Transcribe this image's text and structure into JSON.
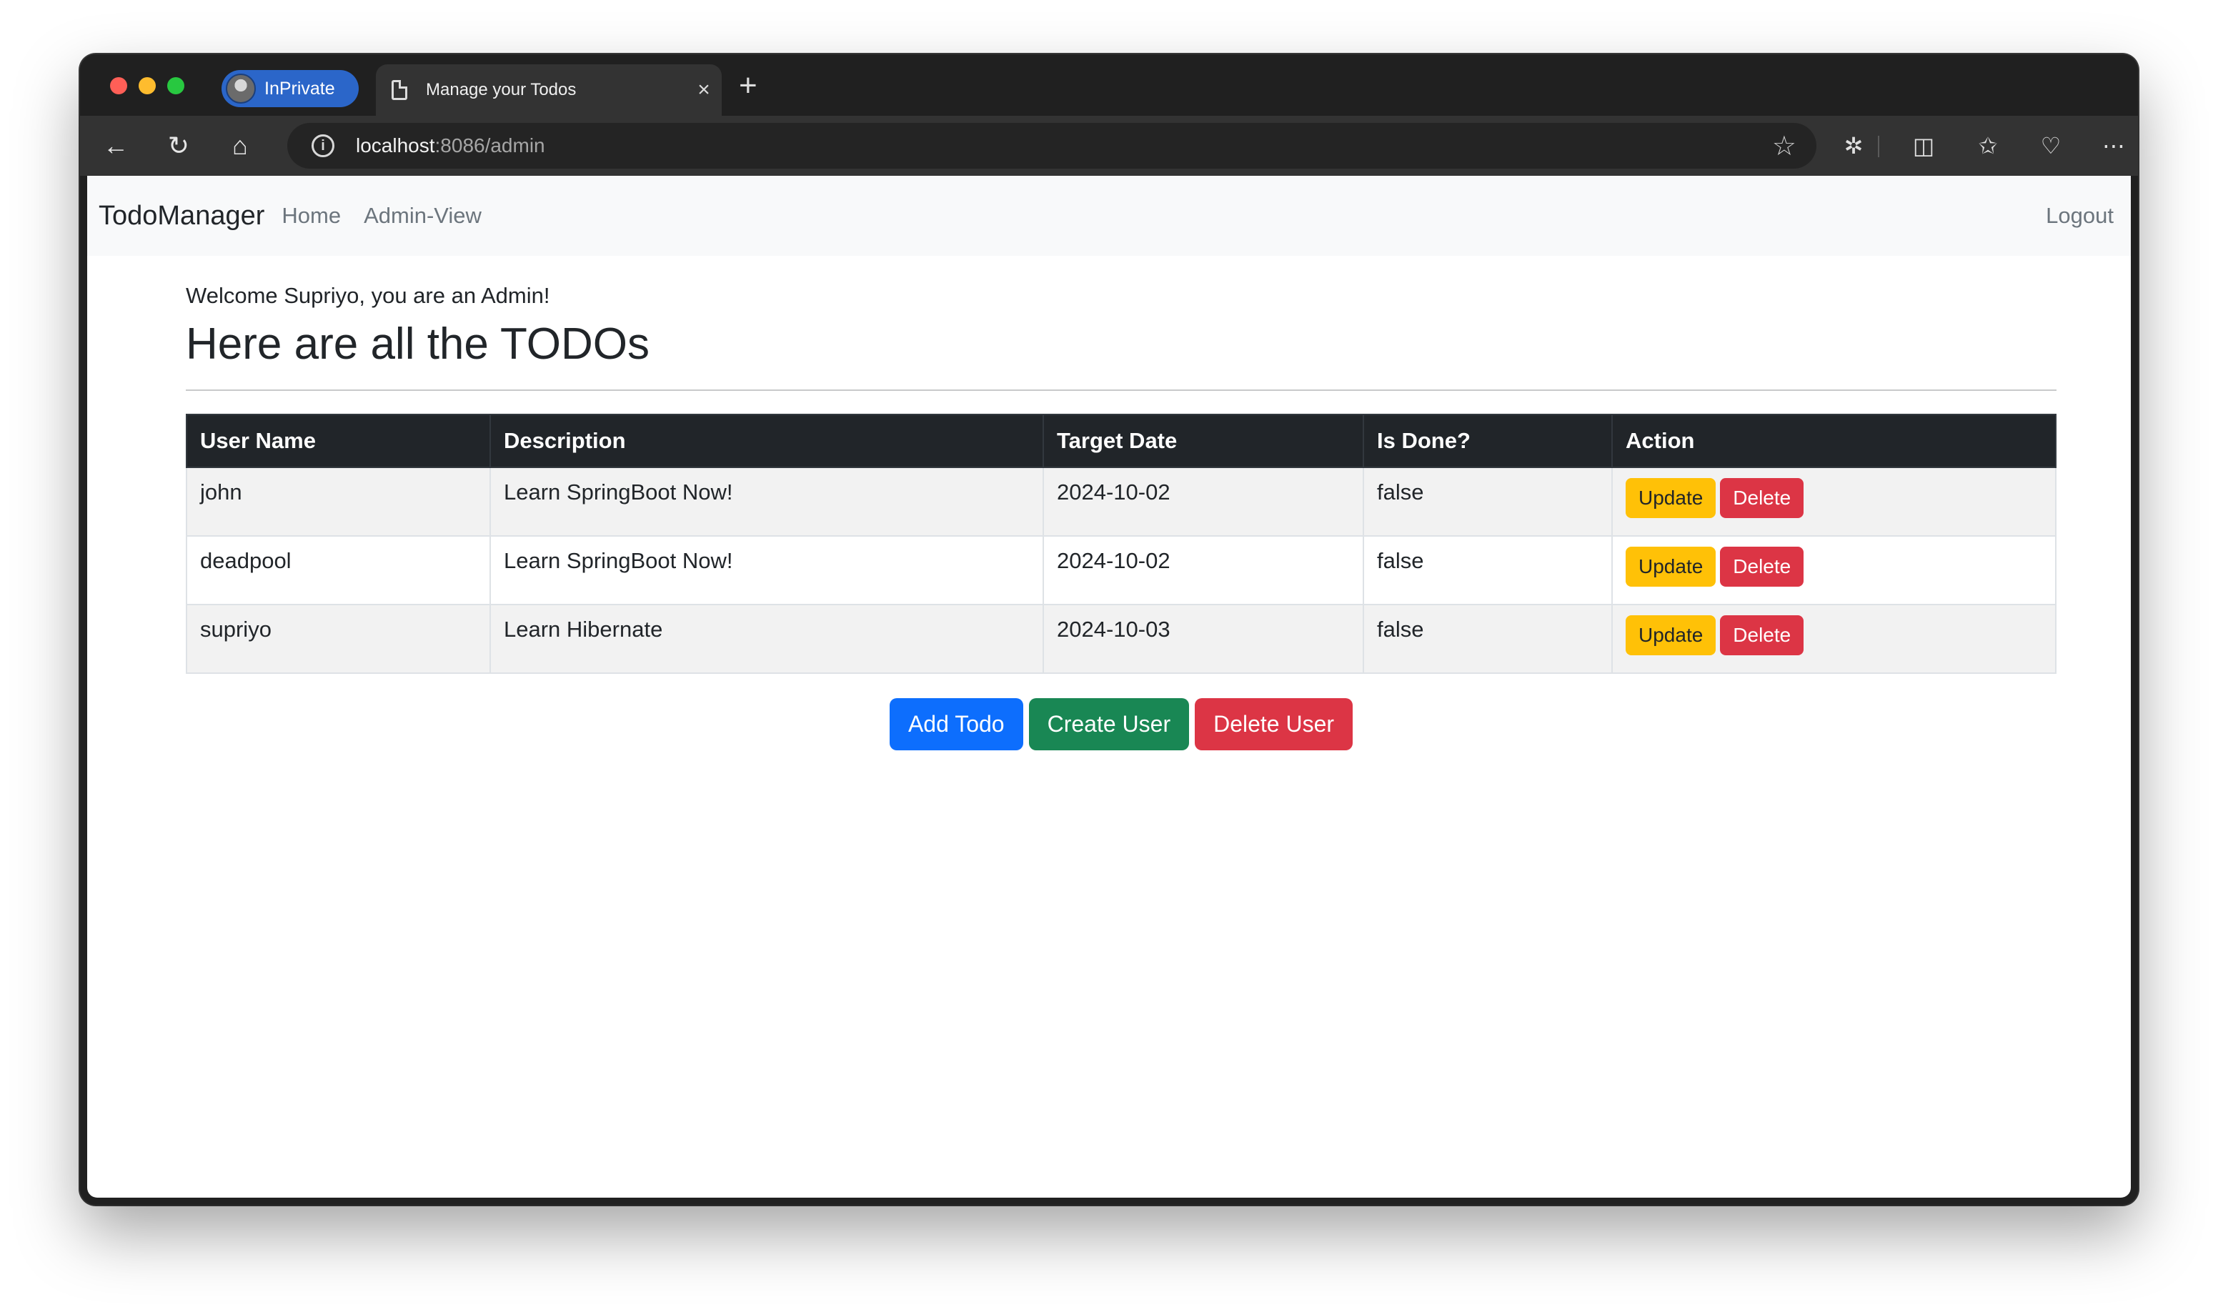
{
  "browser": {
    "profile_label": "InPrivate",
    "tab_title": "Manage your Todos",
    "tab_close": "×",
    "new_tab": "+",
    "url_host": "localhost",
    "url_path": ":8086/admin"
  },
  "nav": {
    "brand": "TodoManager",
    "links": [
      "Home",
      "Admin-View"
    ],
    "logout": "Logout"
  },
  "page": {
    "welcome": "Welcome Supriyo, you are an Admin!",
    "heading": "Here are all the TODOs"
  },
  "table": {
    "headers": [
      "User Name",
      "Description",
      "Target Date",
      "Is Done?",
      "Action"
    ],
    "rows": [
      {
        "user": "john",
        "description": "Learn SpringBoot Now!",
        "target_date": "2024-10-02",
        "done": "false"
      },
      {
        "user": "deadpool",
        "description": "Learn SpringBoot Now!",
        "target_date": "2024-10-02",
        "done": "false"
      },
      {
        "user": "supriyo",
        "description": "Learn Hibernate",
        "target_date": "2024-10-03",
        "done": "false"
      }
    ],
    "update_label": "Update",
    "delete_label": "Delete"
  },
  "actions": {
    "add_todo": "Add Todo",
    "create_user": "Create User",
    "delete_user": "Delete User"
  },
  "colors": {
    "primary": "#0d6efd",
    "success": "#198754",
    "danger": "#dc3545",
    "warning": "#ffc107",
    "table_header": "#212529"
  }
}
